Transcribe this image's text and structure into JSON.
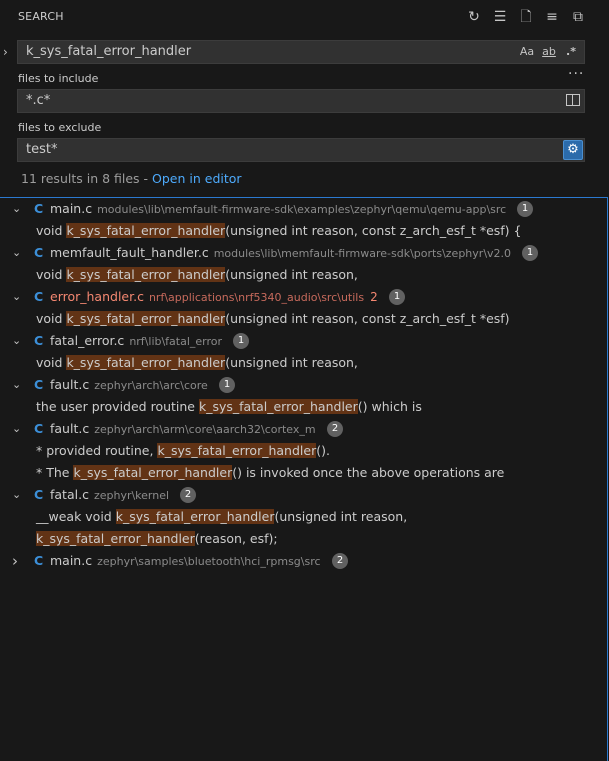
{
  "header": {
    "title": "SEARCH"
  },
  "search": {
    "query": "k_sys_fatal_error_handler",
    "opt_case": "Aa",
    "opt_word": "ab",
    "opt_regex": ".*"
  },
  "include": {
    "label": "files to include",
    "value": "*.c*"
  },
  "exclude": {
    "label": "files to exclude",
    "value": "test*"
  },
  "summary": {
    "text": "11 results in 8 files - ",
    "link": "Open in editor"
  },
  "files": [
    {
      "name": "main.c",
      "path": "modules\\lib\\memfault-firmware-sdk\\examples\\zephyr\\qemu\\qemu-app\\src",
      "count": "1",
      "expanded": true,
      "error": false,
      "matches": [
        {
          "pre": "void ",
          "hit": "k_sys_fatal_error_handler",
          "post": "(unsigned int reason, const z_arch_esf_t *esf) {"
        }
      ]
    },
    {
      "name": "memfault_fault_handler.c",
      "path": "modules\\lib\\memfault-firmware-sdk\\ports\\zephyr\\v2.0",
      "count": "1",
      "expanded": true,
      "error": false,
      "matches": [
        {
          "pre": "void ",
          "hit": "k_sys_fatal_error_handler",
          "post": "(unsigned int reason,"
        }
      ]
    },
    {
      "name": "error_handler.c",
      "path": "nrf\\applications\\nrf5340_audio\\src\\utils",
      "errors": "2",
      "count": "1",
      "expanded": true,
      "error": true,
      "matches": [
        {
          "pre": "void ",
          "hit": "k_sys_fatal_error_handler",
          "post": "(unsigned int reason, const z_arch_esf_t *esf)"
        }
      ]
    },
    {
      "name": "fatal_error.c",
      "path": "nrf\\lib\\fatal_error",
      "count": "1",
      "expanded": true,
      "error": false,
      "matches": [
        {
          "pre": "void ",
          "hit": "k_sys_fatal_error_handler",
          "post": "(unsigned int reason,"
        }
      ]
    },
    {
      "name": "fault.c",
      "path": "zephyr\\arch\\arc\\core",
      "count": "1",
      "expanded": true,
      "error": false,
      "matches": [
        {
          "pre": "the user provided routine ",
          "hit": "k_sys_fatal_error_handler",
          "post": "() which is"
        }
      ]
    },
    {
      "name": "fault.c",
      "path": "zephyr\\arch\\arm\\core\\aarch32\\cortex_m",
      "count": "2",
      "expanded": true,
      "error": false,
      "matches": [
        {
          "pre": "*   provided routine, ",
          "hit": "k_sys_fatal_error_handler",
          "post": "()."
        },
        {
          "pre": "* The ",
          "hit": "k_sys_fatal_error_handler",
          "post": "() is invoked once the above operations are"
        }
      ]
    },
    {
      "name": "fatal.c",
      "path": "zephyr\\kernel",
      "count": "2",
      "expanded": true,
      "error": false,
      "matches": [
        {
          "pre": "__weak void ",
          "hit": "k_sys_fatal_error_handler",
          "post": "(unsigned int reason,"
        },
        {
          "pre": "",
          "hit": "k_sys_fatal_error_handler",
          "post": "(reason, esf);"
        }
      ]
    },
    {
      "name": "main.c",
      "path": "zephyr\\samples\\bluetooth\\hci_rpmsg\\src",
      "count": "2",
      "expanded": false,
      "error": false,
      "matches": []
    }
  ],
  "icons": {
    "refresh": "refresh-icon",
    "clear": "clear-results-icon",
    "new": "new-search-editor-icon",
    "collapse": "collapse-all-icon",
    "view": "view-as-tree-icon"
  },
  "colors": {
    "accent": "#2b79d0",
    "highlight": "#623315",
    "error": "#f48771",
    "link": "#4daafc"
  }
}
